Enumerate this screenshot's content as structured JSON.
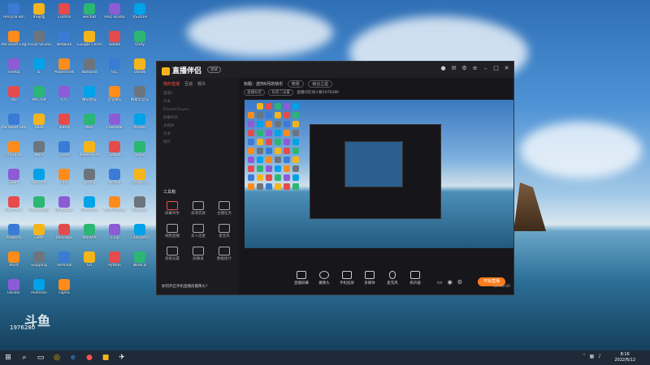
{
  "colors": {
    "accent": "#ff7a1a",
    "brand": "#f5b51a",
    "tab_active": "#f0504a"
  },
  "app": {
    "name": "直播伴侣",
    "version_badge": "测试",
    "sidebar_tabs": [
      "我的直播",
      "互动",
      "观众"
    ],
    "sidebar_items": [
      "直播1",
      "文本",
      "DisableTruyen",
      "屏幕共享",
      "多媒体",
      "文本",
      "图片"
    ],
    "tools_title": "工具箱",
    "tools": [
      "屏幕共享",
      "高清音质",
      "主播任务",
      "视频直播",
      "多人连麦",
      "麦克风",
      "高级设置",
      "屏幕录",
      "数据统计"
    ],
    "stream_title_label": "标题：",
    "stream_title": "送你6月的快乐",
    "edit_label": "修改",
    "category": "综合之星",
    "tags": [
      "直播标签",
      "标签二设置"
    ],
    "info_text": "直播间在线人数1976280",
    "controls": [
      "直播屏幕",
      "摄像头",
      "手机投屏",
      "多媒体",
      "麦克风",
      "扬声器"
    ],
    "start_button": "开始直播",
    "bottom_tip": "如何开启手机直播前摄像头?",
    "status_time": "00:00:00"
  },
  "watermark": {
    "logo": "斗鱼",
    "room_id": "1976280"
  },
  "taskbar": {
    "time": "8:16",
    "date": "2022/6/12"
  },
  "desktop_icons": [
    "Recycle Bin",
    "IIS管理",
    "Control",
    "wechat",
    "RAD Studio",
    "VS2019",
    "Microsoft Edge",
    "Visual Studio",
    "Network",
    "Google Chrome",
    "Adobe",
    "Unity",
    "Firefox",
    "IE",
    "PowerShell",
    "Notepad",
    "VLC",
    "Steam",
    "QQ",
    "WeChat",
    "钉钉",
    "腾讯会议",
    "企业微信",
    "网易云音乐",
    "Microsoft Store",
    "Xbox",
    "Teams",
    "Mail",
    "Calendar",
    "Photos",
    "OneDrive",
    "Word",
    "Excel",
    "PowerPoint",
    "Outlook",
    "Skype",
    "Zoom",
    "Discord",
    "OBS",
    "Spotify",
    "Netflix",
    "Dropbox",
    "Evernote",
    "Photoshop",
    "Illustrator",
    "Premiere",
    "After Effects",
    "Blender",
    "Audacity",
    "GIMP",
    "Inkscape",
    "WinRAR",
    "7-Zip",
    "Calculator",
    "Paint",
    "Snipping",
    "Terminal",
    "Git",
    "Python",
    "Node.js",
    "Docker",
    "Postman",
    "Figma"
  ]
}
